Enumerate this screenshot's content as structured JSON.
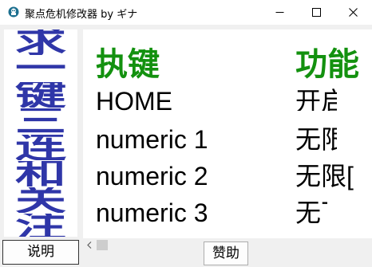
{
  "window": {
    "title": "聚点危机修改器 by ギナ",
    "icon": "app-icon"
  },
  "title_controls": {
    "minimize_icon": "minimize-icon",
    "maximize_icon": "maximize-icon",
    "close_icon": "close-icon"
  },
  "side_banner": {
    "chars": [
      "求",
      "一",
      "键",
      "三",
      "连",
      "和",
      "关",
      "注"
    ],
    "color": "#2f36a8"
  },
  "table": {
    "headers": {
      "hotkey": "执键",
      "function": "功能"
    },
    "header_color": "#13910f",
    "rows": [
      {
        "hotkey": "HOME",
        "function": "开启"
      },
      {
        "hotkey": "numeric 1",
        "function": "无限"
      },
      {
        "hotkey": "numeric 2",
        "function": "无限["
      },
      {
        "hotkey": "numeric 3",
        "function": "无下"
      }
    ]
  },
  "buttons": {
    "help": "说明",
    "donate": "赞助"
  }
}
